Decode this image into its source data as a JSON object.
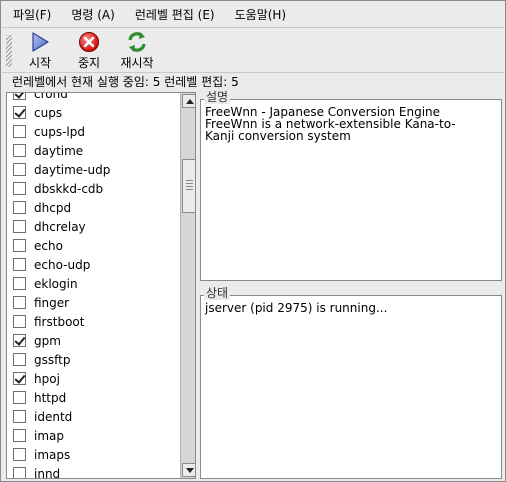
{
  "menubar": {
    "items": [
      {
        "label": "파일(F)"
      },
      {
        "label": "명령 (A)"
      },
      {
        "label": "런레벨 편집 (E)"
      },
      {
        "label": "도움말(H)"
      }
    ]
  },
  "toolbar": {
    "start_label": "시작",
    "stop_label": "중지",
    "restart_label": "재시작"
  },
  "status_line": "런레벨에서 현재 실행 중임: 5  런레벨 편집: 5",
  "services": [
    {
      "name": "crond",
      "checked": true
    },
    {
      "name": "cups",
      "checked": true
    },
    {
      "name": "cups-lpd",
      "checked": false
    },
    {
      "name": "daytime",
      "checked": false
    },
    {
      "name": "daytime-udp",
      "checked": false
    },
    {
      "name": "dbskkd-cdb",
      "checked": false
    },
    {
      "name": "dhcpd",
      "checked": false
    },
    {
      "name": "dhcrelay",
      "checked": false
    },
    {
      "name": "echo",
      "checked": false
    },
    {
      "name": "echo-udp",
      "checked": false
    },
    {
      "name": "eklogin",
      "checked": false
    },
    {
      "name": "finger",
      "checked": false
    },
    {
      "name": "firstboot",
      "checked": false
    },
    {
      "name": "gpm",
      "checked": true
    },
    {
      "name": "gssftp",
      "checked": false
    },
    {
      "name": "hpoj",
      "checked": true
    },
    {
      "name": "httpd",
      "checked": false
    },
    {
      "name": "identd",
      "checked": false
    },
    {
      "name": "imap",
      "checked": false
    },
    {
      "name": "imaps",
      "checked": false
    },
    {
      "name": "innd",
      "checked": false
    }
  ],
  "description": {
    "label": "설명",
    "text": "FreeWnn - Japanese Conversion Engine\nFreeWnn is a network-extensible Kana-to-\nKanji conversion system"
  },
  "status": {
    "label": "상태",
    "text": "jserver (pid 2975) is running..."
  }
}
